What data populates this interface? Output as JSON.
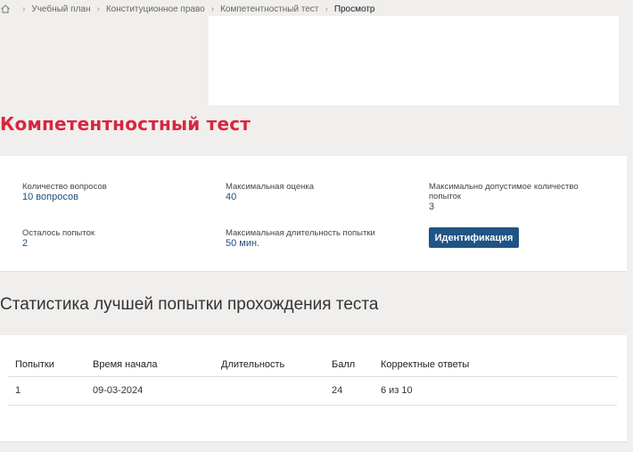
{
  "breadcrumb": {
    "home_icon": "home-icon",
    "items": [
      "Учебный план",
      "Конституционное право",
      "Компетентностный тест",
      "Просмотр"
    ]
  },
  "page_title": "Компетентностный тест",
  "info": {
    "questions_label": "Количество вопросов",
    "questions_value": "10 вопросов",
    "max_score_label": "Максимальная оценка",
    "max_score_value": "40",
    "max_attempts_label": "Максимально допустимое количество попыток",
    "max_attempts_value": "3",
    "remaining_label": "Осталось попыток",
    "remaining_value": "2",
    "max_duration_label": "Максимальная длительность попытки",
    "max_duration_value": "50 мин.",
    "identify_button": "Идентификация"
  },
  "stats": {
    "title": "Статистика лучшей попытки прохождения теста",
    "headers": [
      "Попытки",
      "Время начала",
      "Длительность",
      "Балл",
      "Корректные ответы"
    ],
    "rows": [
      [
        "1",
        "09-03-2024",
        "",
        "24",
        "6 из 10"
      ]
    ]
  },
  "colors": {
    "title_red": "#d8263e",
    "button_blue": "#1f5485",
    "value_blue": "#1f4e7a"
  }
}
